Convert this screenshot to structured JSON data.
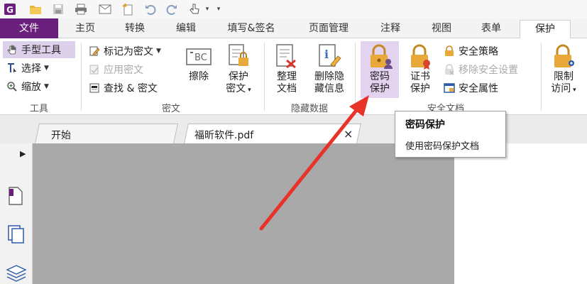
{
  "menu": {
    "file": "文件",
    "tabs": [
      "主页",
      "转换",
      "编辑",
      "填写&签名",
      "页面管理",
      "注释",
      "视图",
      "表单",
      "保护"
    ]
  },
  "tools_group": {
    "hand": "手型工具",
    "select": "选择",
    "zoom": "缩放",
    "label": "工具"
  },
  "redact_group": {
    "mark": "标记为密文",
    "apply": "应用密文",
    "find": "查找 & 密文",
    "erase": "擦除",
    "protect_line1": "保护",
    "protect_line2": "密文",
    "label": "密文"
  },
  "hidden_group": {
    "organize_line1": "整理",
    "organize_line2": "文档",
    "delete_line1": "删除隐",
    "delete_line2": "藏信息",
    "label": "隐藏数据"
  },
  "security_group": {
    "pwd_line1": "密码",
    "pwd_line2": "保护",
    "cert_line1": "证书",
    "cert_line2": "保护",
    "policy": "安全策略",
    "remove": "移除安全设置",
    "props": "安全属性",
    "label": "安全文档"
  },
  "restrict_group": {
    "line1": "限制",
    "line2": "访问"
  },
  "doc_tabs": {
    "start": "开始",
    "file": "福昕软件.pdf",
    "close": "×"
  },
  "tooltip": {
    "title": "密码保护",
    "desc": "使用密码保护文档"
  },
  "colors": {
    "brand": "#6b1f7c",
    "selected": "#e3d3ef",
    "arrow": "#e8332a"
  }
}
